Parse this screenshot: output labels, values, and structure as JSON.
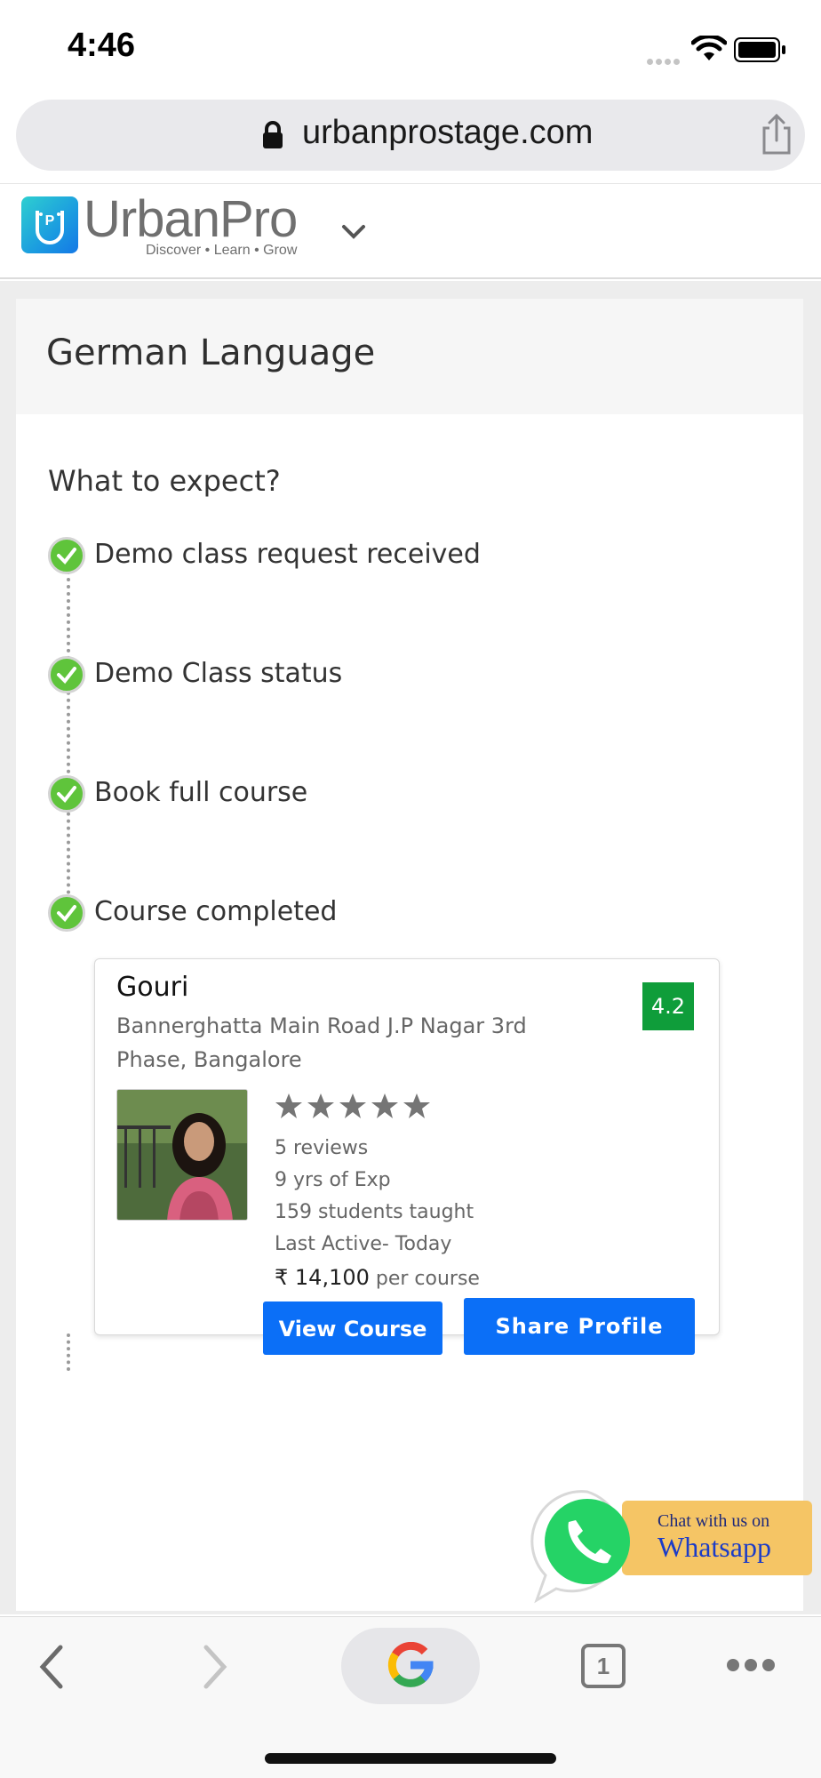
{
  "status_bar": {
    "time": "4:46"
  },
  "address_bar": {
    "url": "urbanprostage.com"
  },
  "site": {
    "logo_text": "UrbanPro",
    "tagline": "Discover • Learn • Grow"
  },
  "course": {
    "title": "German Language"
  },
  "expect": {
    "title": "What to expect?",
    "steps": [
      {
        "label": "Demo class request received",
        "done": true
      },
      {
        "label": "Demo Class status",
        "done": true
      },
      {
        "label": "Book full course",
        "done": true
      },
      {
        "label": "Course completed",
        "done": true
      }
    ]
  },
  "tutor": {
    "name": "Gouri",
    "address": "Bannerghatta Main Road J.P Nagar 3rd Phase, Bangalore",
    "rating": "4.2",
    "stars": 5,
    "reviews": "5 reviews",
    "experience": "9 yrs of Exp",
    "students": "159 students taught",
    "last_active": "Last Active- Today",
    "price_amount": "₹ 14,100",
    "price_unit": "per course",
    "view_course_label": "View Course",
    "share_profile_label": "Share Profile"
  },
  "whatsapp": {
    "line1": "Chat with us on",
    "line2": "Whatsapp"
  },
  "toolbar": {
    "tab_count": "1"
  },
  "colors": {
    "primary_button": "#0b6ff7",
    "rating_badge": "#0f9d3a",
    "check_green": "#5fc43b",
    "whatsapp_green": "#25d366",
    "whatsapp_banner": "#f5c565"
  }
}
